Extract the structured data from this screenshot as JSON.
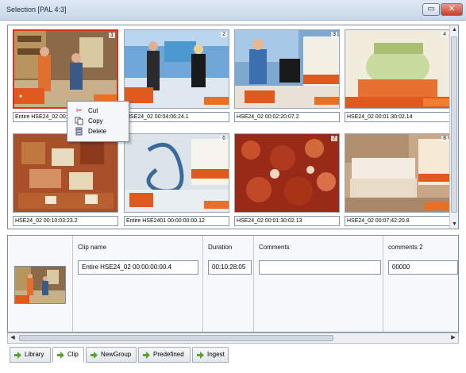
{
  "window": {
    "title": "Selection [PAL 4:3]",
    "restore_glyph": "▭",
    "close_glyph": "✕"
  },
  "thumbnails": [
    {
      "index": "1",
      "caption": "Entire HSE24_02 00:00:00:00.4"
    },
    {
      "index": "2",
      "caption": "HSE24_02 00:04:06:24.1"
    },
    {
      "index": "3",
      "caption": "HSE24_02 00:02:20:07.2"
    },
    {
      "index": "4",
      "caption": "HSE24_02 00:01:30:02.14"
    },
    {
      "index": "5",
      "caption": "HSE24_02 00:10:03:23.2"
    },
    {
      "index": "6",
      "caption": "Entire HSE2401 00:00:00:00.12"
    },
    {
      "index": "7",
      "caption": "HSE24_02 00:01:30:02.13"
    },
    {
      "index": "8",
      "caption": "HSE24_02 00:07:42:20.8"
    }
  ],
  "context_menu": {
    "cut": "Cut",
    "copy": "Copy",
    "delete": "Delete"
  },
  "detail": {
    "columns": {
      "clip_name": "Clip name",
      "duration": "Duration",
      "comments": "Comments",
      "comments2": "comments 2"
    },
    "values": {
      "clip_name": "Entire HSE24_02 00:00:00:00.4",
      "duration": "00:10:28:05",
      "comments": "",
      "comments2": "00000"
    }
  },
  "tabs": [
    "Library",
    "Clip",
    "NewGroup",
    "Predefined",
    "Ingest"
  ],
  "active_tab": "Clip",
  "colors": {
    "selection_border": "#e03020",
    "tab_icon": "#5aa02c"
  }
}
